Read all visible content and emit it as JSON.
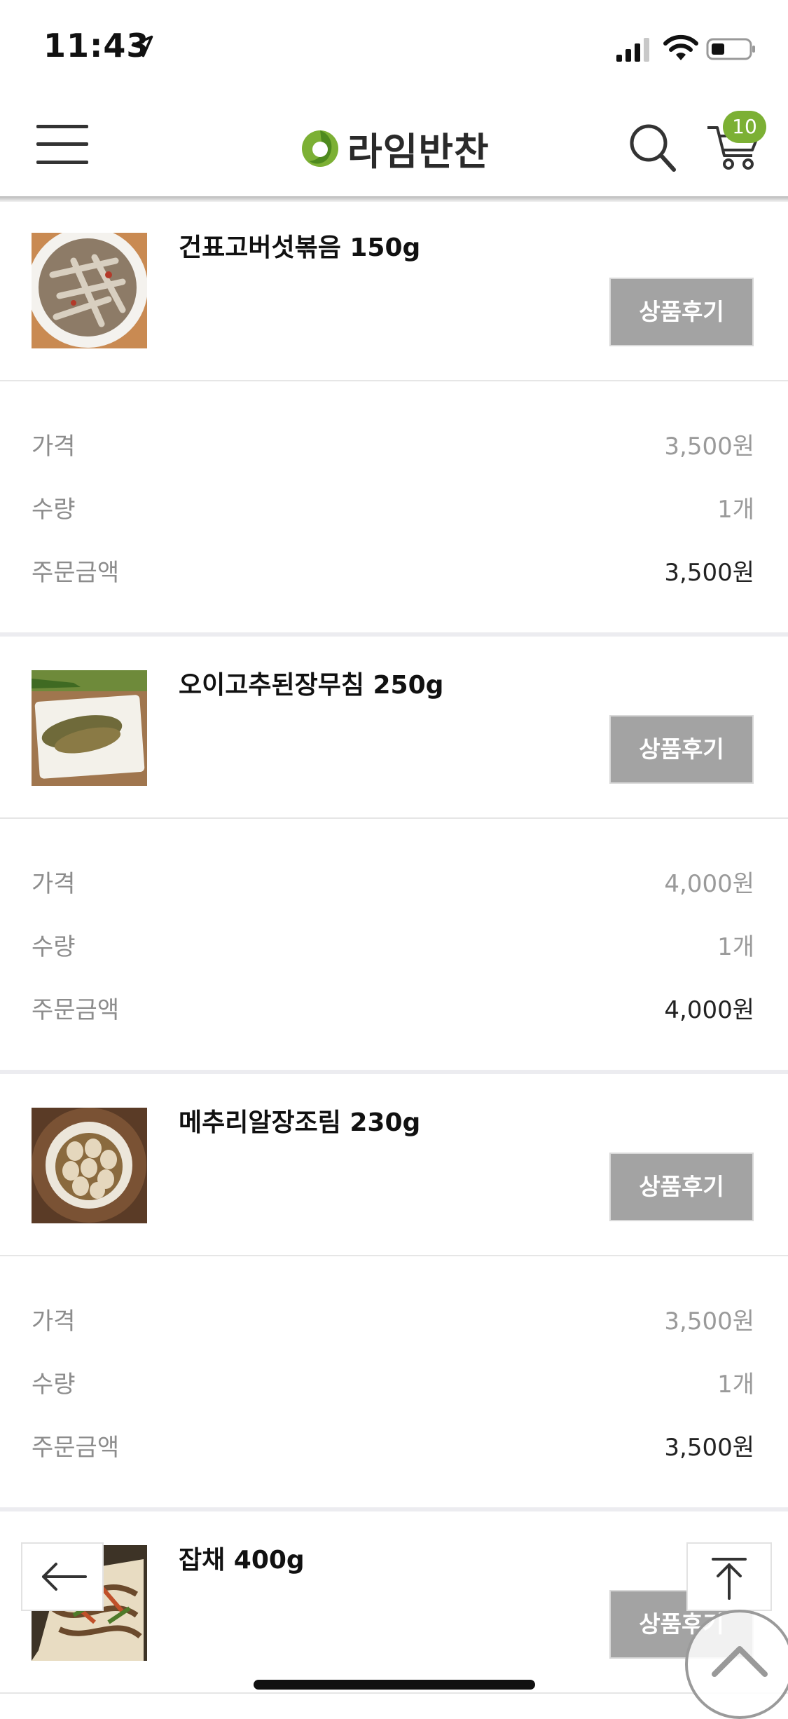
{
  "status_bar": {
    "time": "11:43"
  },
  "header": {
    "brand": "라임반찬",
    "cart_count": "10"
  },
  "items": [
    {
      "name": "건표고버섯볶음 150g",
      "review_label": "상품후기",
      "price_label": "가격",
      "price": "3,500원",
      "qty_label": "수량",
      "qty": "1개",
      "total_label": "주문금액",
      "total": "3,500원"
    },
    {
      "name": "오이고추된장무침 250g",
      "review_label": "상품후기",
      "price_label": "가격",
      "price": "4,000원",
      "qty_label": "수량",
      "qty": "1개",
      "total_label": "주문금액",
      "total": "4,000원"
    },
    {
      "name": "메추리알장조림 230g",
      "review_label": "상품후기",
      "price_label": "가격",
      "price": "3,500원",
      "qty_label": "수량",
      "qty": "1개",
      "total_label": "주문금액",
      "total": "3,500원"
    },
    {
      "name": "잡채 400g",
      "review_label": "상품후기"
    }
  ],
  "colors": {
    "accent": "#7cb034",
    "review_button": "#a3a3a3"
  },
  "icons": [
    "menu-icon",
    "search-icon",
    "cart-icon",
    "back-arrow-icon",
    "scroll-top-icon",
    "chevron-up-icon"
  ]
}
